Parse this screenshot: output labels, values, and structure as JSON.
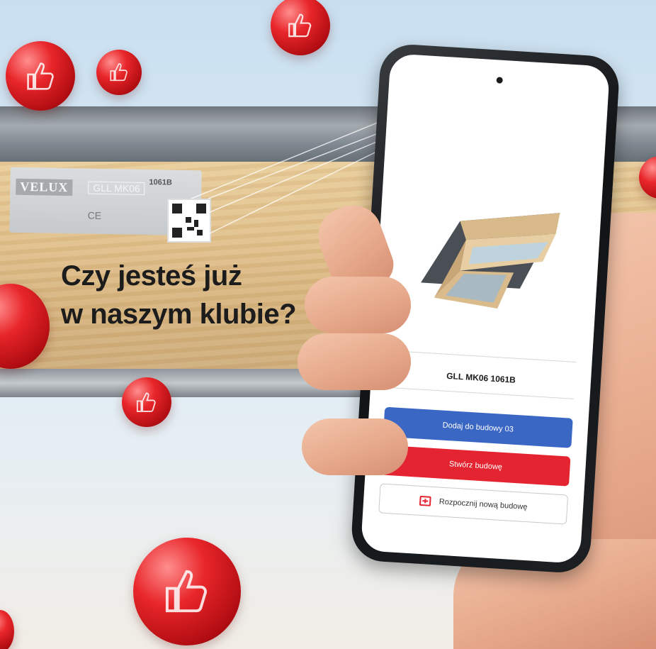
{
  "headline": {
    "line1": "Czy jesteś już",
    "line2": "w naszym klubie?"
  },
  "label_plate": {
    "brand": "VELUX",
    "model": "GLL MK06",
    "code": "1061B",
    "mark": "CE"
  },
  "phone_app": {
    "product_title": "GLL MK06 1061B",
    "add_button": "Dodaj do budowy 03",
    "create_button": "Stwórz budowę",
    "start_button": "Rozpocznij nową budowę"
  },
  "colors": {
    "blue_button": "#3a67c4",
    "red_button": "#e42430",
    "ball_red": "#e8262a"
  },
  "icons": [
    "thumbs-up-icon",
    "plus-folder-icon",
    "camera-icon",
    "qr-code-icon"
  ]
}
